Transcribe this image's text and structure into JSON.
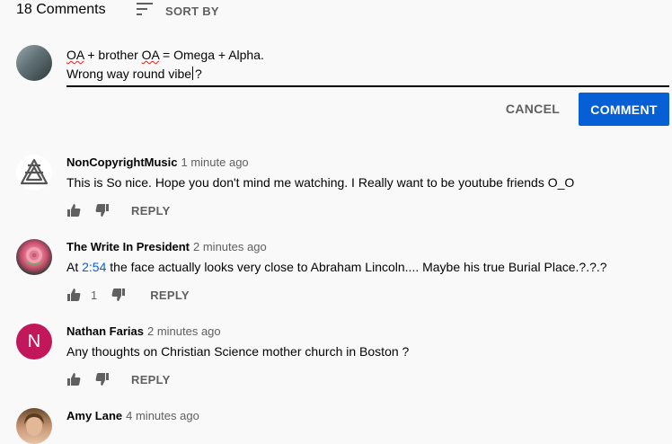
{
  "header": {
    "comment_count": "18 Comments",
    "sort_label": "SORT BY"
  },
  "compose": {
    "line1_part_a": "OA",
    "line1_part_b": " + brother ",
    "line1_part_c": "OA",
    "line1_part_d": " = Omega + Alpha.",
    "line2_before_caret": "Wrong way round vibe",
    "line2_after_caret": "?",
    "cancel_label": "CANCEL",
    "comment_label": "COMMENT"
  },
  "comments": [
    {
      "author": "NonCopyrightMusic",
      "time": "1 minute ago",
      "text": "This is So nice. Hope you don't mind me watching. I Really want to be youtube friends O_O",
      "reply_label": "REPLY"
    },
    {
      "author": "The Write In President",
      "time": "2 minutes ago",
      "text_before": "At ",
      "timestamp_link": "2:54",
      "text_after": " the face actually looks very close to Abraham Lincoln.... Maybe his true Burial Place.?.?.?",
      "like_count": "1",
      "reply_label": "REPLY"
    },
    {
      "author": "Nathan Farias",
      "time": "2 minutes ago",
      "avatar_letter": "N",
      "text": "Any thoughts on Christian Science mother church in Boston ?",
      "reply_label": "REPLY"
    },
    {
      "author": "Amy Lane",
      "time": "4 minutes ago"
    }
  ],
  "icons": {
    "sort": "sort-icon",
    "like": "thumbs-up-icon",
    "dislike": "thumbs-down-icon"
  },
  "colors": {
    "accent": "#065fd4",
    "secondary_text": "#606060",
    "background": "#f9f9f9",
    "nathan_avatar": "#c2185b"
  }
}
